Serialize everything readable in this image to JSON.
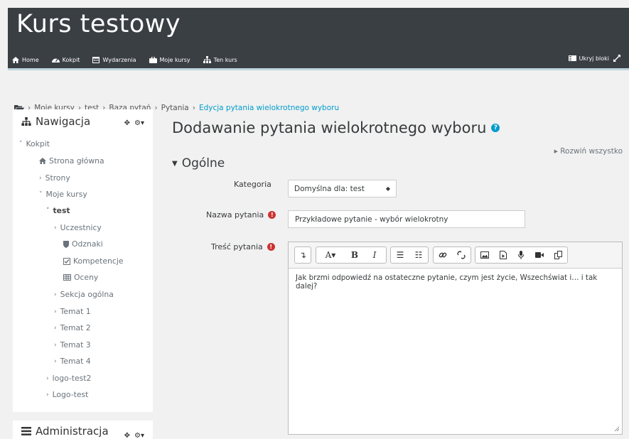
{
  "header": {
    "title": "Kurs testowy",
    "nav": [
      {
        "label": "Home",
        "icon": "home-icon"
      },
      {
        "label": "Kokpit",
        "icon": "dashboard-icon"
      },
      {
        "label": "Wydarzenia",
        "icon": "calendar-icon"
      },
      {
        "label": "Moje kursy",
        "icon": "briefcase-icon"
      },
      {
        "label": "Ten kurs",
        "icon": "sitemap-icon"
      }
    ],
    "hide_blocks": "Ukryj bloki"
  },
  "breadcrumb": {
    "items": [
      "Moje kursy",
      "test",
      "Baza pytań",
      "Pytania",
      "Edycja pytania wielokrotnego wyboru"
    ]
  },
  "nav_block": {
    "title": "Nawigacja",
    "items": [
      {
        "label": "Kokpit"
      },
      {
        "label": "Strona główna"
      },
      {
        "label": "Strony"
      },
      {
        "label": "Moje kursy"
      },
      {
        "label": "test"
      },
      {
        "label": "Uczestnicy"
      },
      {
        "label": "Odznaki"
      },
      {
        "label": "Kompetencje"
      },
      {
        "label": "Oceny"
      },
      {
        "label": "Sekcja ogólna"
      },
      {
        "label": "Temat 1"
      },
      {
        "label": "Temat 2"
      },
      {
        "label": "Temat 3"
      },
      {
        "label": "Temat 4"
      },
      {
        "label": "logo-test2"
      },
      {
        "label": "Logo-test"
      }
    ]
  },
  "admin_block": {
    "title": "Administracja"
  },
  "main": {
    "title": "Dodawanie pytania wielokrotnego wyboru",
    "expand_all": "Rozwiń wszystko",
    "section": "Ogólne",
    "category_label": "Kategoria",
    "category_value": "Domyślna dla: test",
    "name_label": "Nazwa pytania",
    "name_value": "Przykładowe pytanie - wybór wielokrotny",
    "text_label": "Treść pytania",
    "text_value": "Jak brzmi odpowiedź na ostateczne pytanie, czym jest życie, Wszechświat i… i tak dalej?"
  },
  "colors": {
    "header_bg": "#3a3f44",
    "link": "#009dcc",
    "required": "#cc3333"
  }
}
